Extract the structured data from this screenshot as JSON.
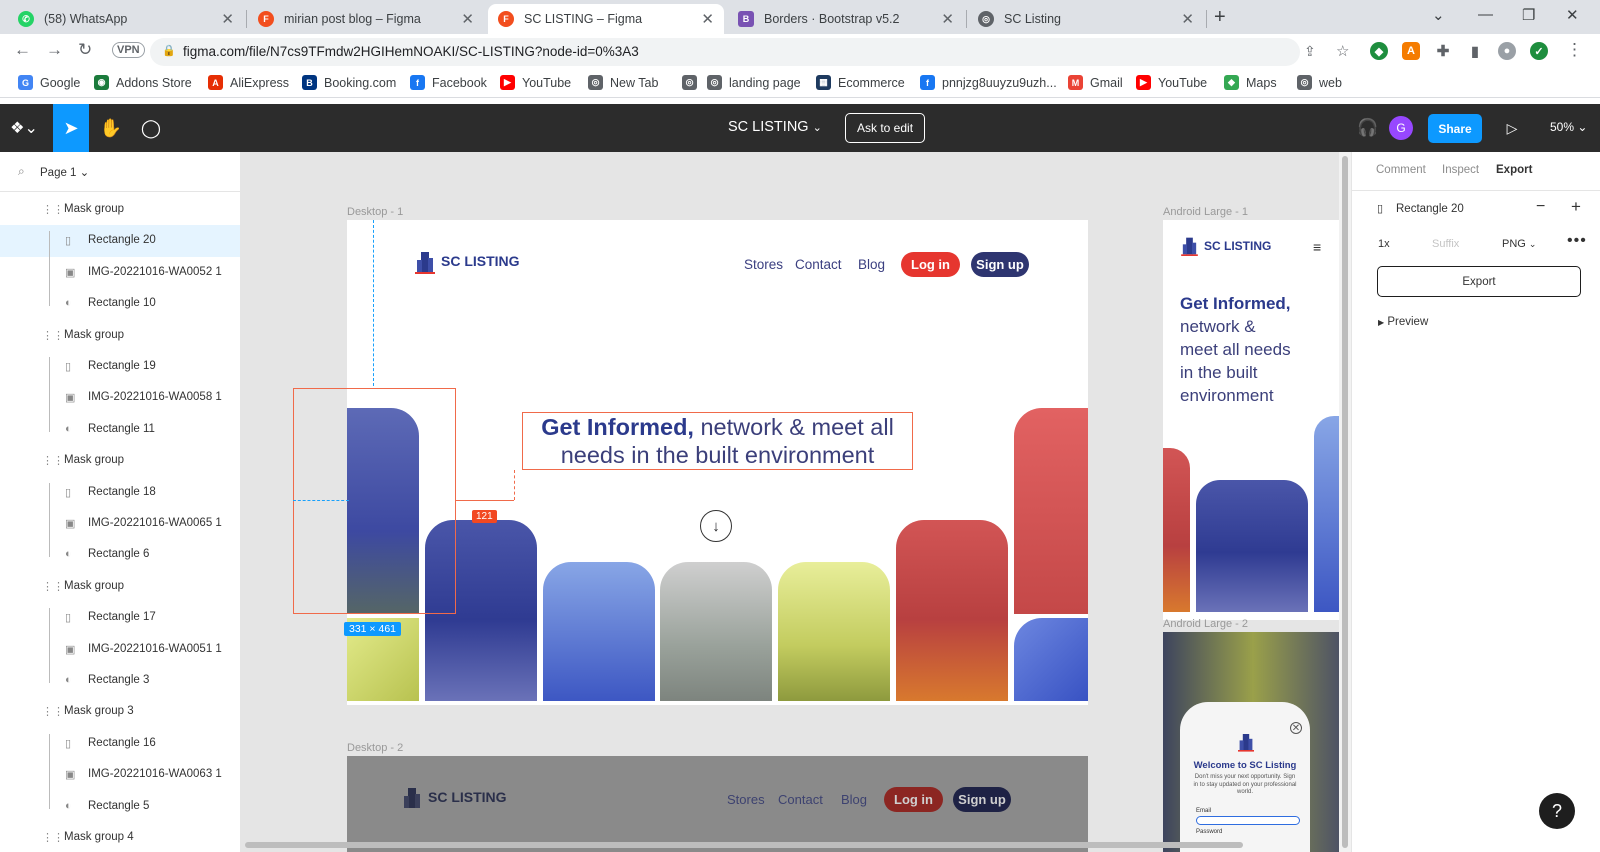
{
  "browser": {
    "tabs": [
      {
        "title": "(58) WhatsApp",
        "icon": "whatsapp-icon",
        "color": "#25d366",
        "glyph": "✆"
      },
      {
        "title": "mirian post blog – Figma",
        "icon": "figma-icon",
        "color": "#f24e1e",
        "glyph": "F"
      },
      {
        "title": "SC LISTING – Figma",
        "icon": "figma-icon",
        "color": "#f24e1e",
        "glyph": "F"
      },
      {
        "title": "Borders · Bootstrap v5.2",
        "icon": "bootstrap-icon",
        "color": "#7952b3",
        "glyph": "B"
      },
      {
        "title": "SC Listing",
        "icon": "globe-icon",
        "color": "#5f6368",
        "glyph": "◎"
      }
    ],
    "new_tab": "+",
    "vpn_label": "VPN",
    "url": "figma.com/file/N7cs9TFmdw2HGIHemNOAKI/SC-LISTING?node-id=0%3A3",
    "bookmarks": [
      {
        "label": "Google",
        "color": "#4285f4",
        "glyph": "G"
      },
      {
        "label": "Addons Store",
        "color": "#1b7b3c",
        "glyph": "◉"
      },
      {
        "label": "AliExpress",
        "color": "#e62e04",
        "glyph": "A"
      },
      {
        "label": "Booking.com",
        "color": "#003580",
        "glyph": "B"
      },
      {
        "label": "Facebook",
        "color": "#1877f2",
        "glyph": "f"
      },
      {
        "label": "YouTube",
        "color": "#ff0000",
        "glyph": "▶"
      },
      {
        "label": "New Tab",
        "color": "#5f6368",
        "glyph": "◎"
      },
      {
        "label": "",
        "color": "#5f6368",
        "glyph": "◎"
      },
      {
        "label": "landing page",
        "color": "#5f6368",
        "glyph": "◎"
      },
      {
        "label": "Ecommerce",
        "color": "#1e3a5f",
        "glyph": "▦"
      },
      {
        "label": "pnnjzg8uuyzu9uzh...",
        "color": "#1877f2",
        "glyph": "f"
      },
      {
        "label": "Gmail",
        "color": "#ea4335",
        "glyph": "M"
      },
      {
        "label": "YouTube",
        "color": "#ff0000",
        "glyph": "▶"
      },
      {
        "label": "Maps",
        "color": "#34a853",
        "glyph": "◆"
      },
      {
        "label": "web",
        "color": "#5f6368",
        "glyph": "◎"
      }
    ]
  },
  "figma": {
    "file_name": "SC LISTING",
    "ask_to_edit": "Ask to edit",
    "user_initial": "G",
    "share_label": "Share",
    "zoom_label": "50%",
    "page_label": "Page 1",
    "layers": [
      {
        "name": "Mask group",
        "kind": "group",
        "indent": 0
      },
      {
        "name": "Rectangle 20",
        "kind": "rect",
        "indent": 1,
        "selected": true
      },
      {
        "name": "IMG-20221016-WA0052 1",
        "kind": "image",
        "indent": 1
      },
      {
        "name": "Rectangle 10",
        "kind": "shape",
        "indent": 1
      },
      {
        "name": "Mask group",
        "kind": "group",
        "indent": 0
      },
      {
        "name": "Rectangle 19",
        "kind": "rect",
        "indent": 1
      },
      {
        "name": "IMG-20221016-WA0058 1",
        "kind": "image",
        "indent": 1
      },
      {
        "name": "Rectangle 11",
        "kind": "shape",
        "indent": 1
      },
      {
        "name": "Mask group",
        "kind": "group",
        "indent": 0
      },
      {
        "name": "Rectangle 18",
        "kind": "rect",
        "indent": 1
      },
      {
        "name": "IMG-20221016-WA0065 1",
        "kind": "image",
        "indent": 1
      },
      {
        "name": "Rectangle 6",
        "kind": "shape",
        "indent": 1
      },
      {
        "name": "Mask group",
        "kind": "group",
        "indent": 0
      },
      {
        "name": "Rectangle 17",
        "kind": "rect",
        "indent": 1
      },
      {
        "name": "IMG-20221016-WA0051 1",
        "kind": "image",
        "indent": 1
      },
      {
        "name": "Rectangle 3",
        "kind": "shape",
        "indent": 1
      },
      {
        "name": "Mask group 3",
        "kind": "group",
        "indent": 0
      },
      {
        "name": "Rectangle 16",
        "kind": "rect",
        "indent": 1
      },
      {
        "name": "IMG-20221016-WA0063 1",
        "kind": "image",
        "indent": 1
      },
      {
        "name": "Rectangle 5",
        "kind": "shape",
        "indent": 1
      },
      {
        "name": "Mask group 4",
        "kind": "group",
        "indent": 0
      }
    ],
    "canvas": {
      "frame1_label": "Desktop - 1",
      "frame2_label": "Desktop - 2",
      "android1_label": "Android Large - 1",
      "android2_label": "Android Large - 2",
      "selection_size": "331 × 461",
      "distance_badge": "121",
      "site": {
        "logo_text": "SC LISTING",
        "nav_stores": "Stores",
        "nav_contact": "Contact",
        "nav_blog": "Blog",
        "login": "Log in",
        "signup": "Sign up",
        "hero_bold": "Get Informed,",
        "hero_rest_line1": "network & meet all",
        "hero_line2": "needs in the built environment",
        "mobile_hero_bold": "Get Informed,",
        "mobile_hero_lines": [
          "network &",
          "meet all needs",
          "in the built",
          "environment"
        ],
        "modal_title": "Welcome to SC Listing",
        "modal_text": "Don't miss your next opportunity. Sign in to stay updated on your professional world.",
        "modal_email_label": "Email",
        "modal_password_label": "Password"
      }
    },
    "inspector": {
      "tabs": [
        "Comment",
        "Inspect",
        "Export"
      ],
      "active_tab": "Export",
      "layer_name": "Rectangle 20",
      "scale": "1x",
      "suffix_placeholder": "Suffix",
      "format": "PNG",
      "export_button": "Export",
      "preview_label": "Preview"
    },
    "help": "?"
  }
}
